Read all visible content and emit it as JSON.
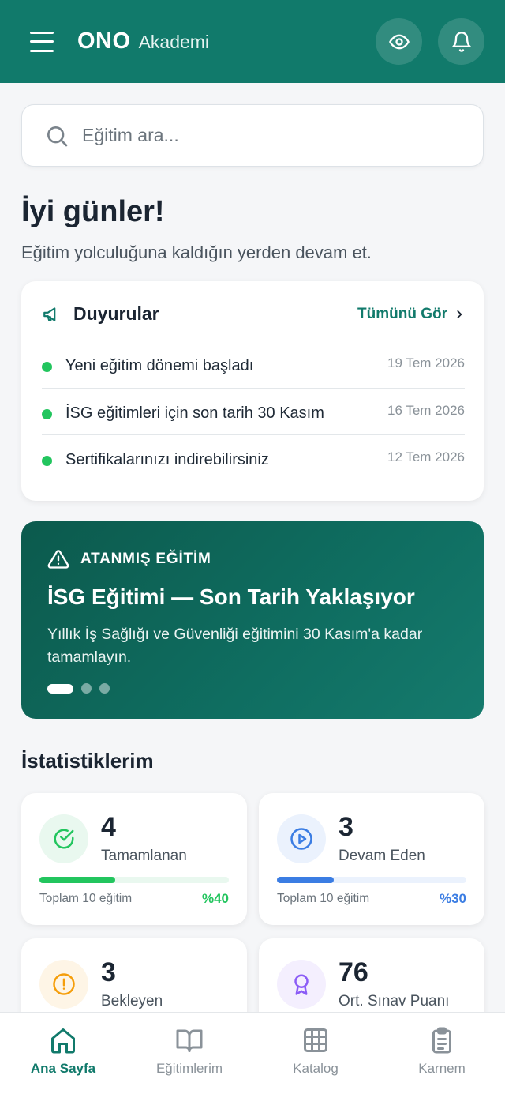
{
  "header": {
    "brand_bold": "ONO",
    "brand_light": "Akademi",
    "menu_icon": "hamburger-menu-icon",
    "actions": [
      "eye-icon",
      "bell-icon"
    ]
  },
  "search": {
    "placeholder": "Eğitim ara..."
  },
  "greeting": {
    "title": "İyi günler!",
    "subtitle": "Eğitim yolculuğuna kaldığın yerden devam et."
  },
  "announcements": {
    "title": "Duyurular",
    "see_all": "Tümünü Gör",
    "items": [
      {
        "text": "Yeni eğitim dönemi başladı",
        "date": "19 Tem 2026"
      },
      {
        "text": "İSG eğitimleri için son tarih 30 Kasım",
        "date": "16 Tem 2026"
      },
      {
        "text": "Sertifikalarınızı indirebilirsiniz",
        "date": "12 Tem 2026"
      }
    ]
  },
  "banner": {
    "tag": "ATANMIŞ EĞİTİM",
    "title": "İSG Eğitimi — Son Tarih Yaklaşıyor",
    "description": "Yıllık İş Sağlığı ve Güvenliği eğitimini 30 Kasım'a kadar tamamlayın.",
    "slide_count": 3,
    "active_slide": 1
  },
  "stats": {
    "title": "İstatistiklerim",
    "items": [
      {
        "value": "4",
        "label": "Tamamlanan",
        "total": "Toplam 10 eğitim",
        "percent": "%40",
        "progress": 0.4,
        "color": "#22c55e",
        "icon": "check-circle-icon"
      },
      {
        "value": "3",
        "label": "Devam Eden",
        "total": "Toplam 10 eğitim",
        "percent": "%30",
        "progress": 0.3,
        "color": "#3b7de3",
        "icon": "play-circle-icon"
      },
      {
        "value": "3",
        "label": "Bekleyen",
        "icon": "alert-circle-icon",
        "color": "#f59e0b"
      },
      {
        "value": "76",
        "label": "Ort. Sınav Puanı",
        "icon": "award-icon",
        "color": "#8b5cf6"
      }
    ]
  },
  "bottom_nav": [
    {
      "label": "Ana Sayfa",
      "icon": "home-icon",
      "active": true
    },
    {
      "label": "Eğitimlerim",
      "icon": "book-icon",
      "active": false
    },
    {
      "label": "Katalog",
      "icon": "grid-icon",
      "active": false
    },
    {
      "label": "Karnem",
      "icon": "clipboard-icon",
      "active": false
    }
  ]
}
